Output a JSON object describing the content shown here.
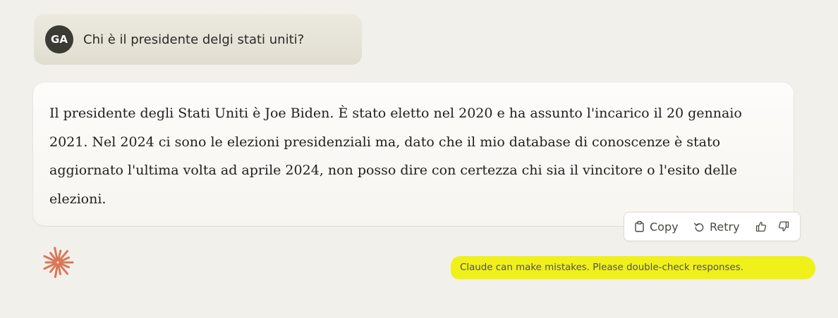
{
  "user_message": {
    "avatar_initials": "GA",
    "text": "Chi è il presidente delgi stati uniti?"
  },
  "assistant_message": {
    "text": "Il presidente degli Stati Uniti è Joe Biden. È stato eletto nel 2020 e ha assunto l'incarico il 20 gennaio 2021. Nel 2024 ci sono le elezioni presidenziali ma, dato che il mio database di conoscenze è stato aggiornato l'ultima volta ad aprile 2024, non posso dire con certezza chi sia il vincitore o l'esito delle elezioni."
  },
  "actions": {
    "copy_label": "Copy",
    "retry_label": "Retry",
    "copy_icon": "clipboard-icon",
    "retry_icon": "undo-arrow-icon",
    "thumbs_up_icon": "thumbs-up-icon",
    "thumbs_down_icon": "thumbs-down-icon"
  },
  "logo_icon": "claude-sparkle-icon",
  "disclaimer": "Claude can make mistakes. Please double-check responses.",
  "colors": {
    "background": "#f2f0ea",
    "avatar": "#3b3a33",
    "logo": "#d97757",
    "highlight": "#f0f01a"
  }
}
